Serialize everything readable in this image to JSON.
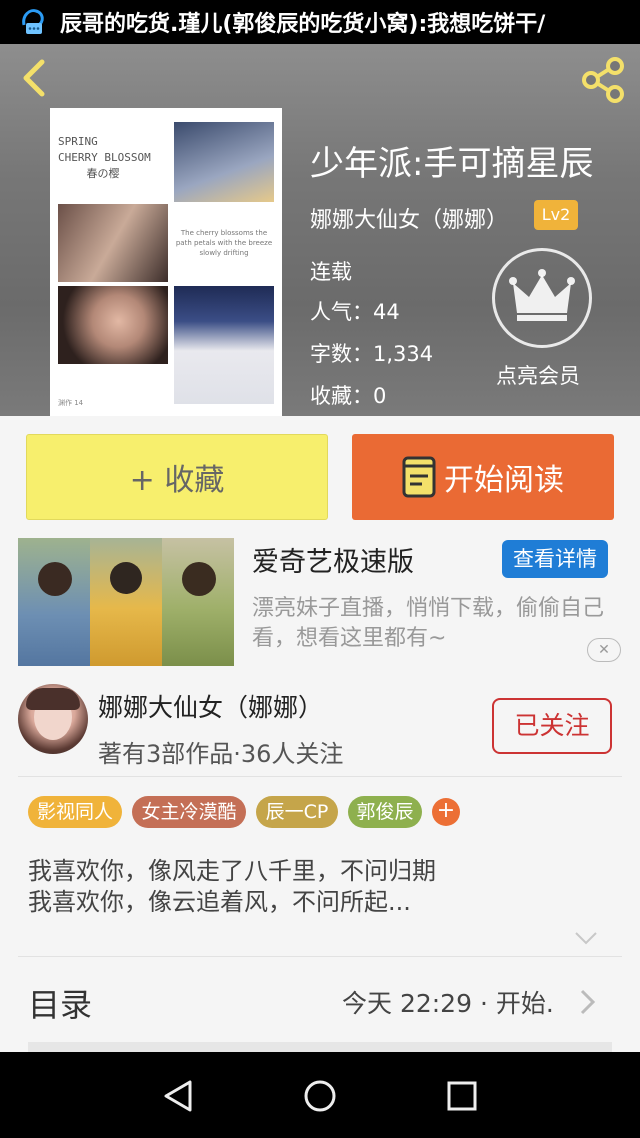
{
  "status_bar": {
    "notification_icon": "chat-bubble-icon",
    "text": "辰哥的吃货.瑾儿(郭俊辰的吃货小窝):我想吃饼干/"
  },
  "header": {
    "back_icon": "chevron-left-icon",
    "share_icon": "share-icon"
  },
  "cover": {
    "title_line1": "SPRING",
    "title_line2": "CHERRY BLOSSOM",
    "title_line3": "春の樱",
    "text": "The cherry blossoms the path petals with the breeze slowly drifting",
    "footer": "渊作 14"
  },
  "book": {
    "title": "少年派:手可摘星辰",
    "author": "娜娜大仙女（娜娜）",
    "level": "Lv2",
    "status": "连载",
    "popularity_label": "人气：",
    "popularity": "44",
    "words_label": "字数：",
    "words": "1,334",
    "favorites_label": "收藏：",
    "favorites": "0"
  },
  "vip": {
    "icon": "crown-icon",
    "label": "点亮会员"
  },
  "actions": {
    "collect_label": "+ 收藏",
    "read_label": "开始阅读",
    "read_icon": "book-icon"
  },
  "ad": {
    "title": "爱奇艺极速版",
    "button_label": "查看详情",
    "description": "漂亮妹子直播，悄悄下载，偷偷自己看，想看这里都有~",
    "close_label": "✕"
  },
  "author_card": {
    "name": "娜娜大仙女（娜娜）",
    "stats": "著有3部作品·36人关注",
    "follow_label": "已关注"
  },
  "tags": [
    {
      "label": "影视同人",
      "color": "#f0b33a"
    },
    {
      "label": "女主冷漠酷",
      "color": "#c46f56"
    },
    {
      "label": "辰一CP",
      "color": "#c5a54a"
    },
    {
      "label": "郭俊辰",
      "color": "#8eb04e"
    }
  ],
  "tag_add_label": "+",
  "description": {
    "line1": "我喜欢你，像风走了八千里，不问归期",
    "line2": "我喜欢你，像云追着风，不问所起..."
  },
  "toc": {
    "label": "目录",
    "update": "今天 22:29 · 开始."
  },
  "nav": {
    "back": "back-triangle-icon",
    "home": "home-circle-icon",
    "recent": "recent-square-icon"
  },
  "colors": {
    "accent_orange": "#ea6a34",
    "collect_yellow": "#f7ef6d",
    "follow_red": "#cc3333",
    "ad_blue": "#1f7dd6"
  }
}
